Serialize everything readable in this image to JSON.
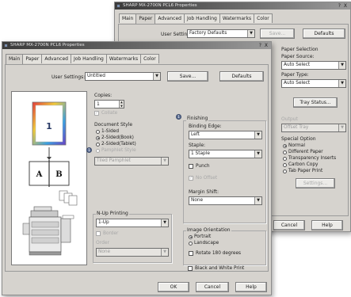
{
  "back": {
    "title": "SHARP MX-2700N PCL6 Properties",
    "close_glyph": "? X",
    "tabs": [
      "Main",
      "Paper",
      "Advanced",
      "Job Handling",
      "Watermarks",
      "Color"
    ],
    "user_settings_label": "User Settings:",
    "user_settings_value": "Factory Defaults",
    "save_label": "Save...",
    "defaults_label": "Defaults",
    "paper_selection_title": "Paper Selection",
    "paper_source_label": "Paper Source:",
    "paper_source_value": "Auto Select",
    "paper_type_label": "Paper Type:",
    "paper_type_value": "Auto Select",
    "tray_status_label": "Tray Status...",
    "output_label": "Output",
    "output_value": "Offset Tray",
    "special_option_title": "Special Option",
    "special_options": [
      "Normal",
      "Different Paper",
      "Transparency Inserts",
      "Carbon Copy",
      "Tab Paper Print"
    ],
    "settings_label": "Settings...",
    "cancel_label": "Cancel",
    "help_label": "Help"
  },
  "front": {
    "title": "SHARP MX-2700N PCL6 Properties",
    "close_glyph": "? X",
    "tabs": [
      "Main",
      "Paper",
      "Advanced",
      "Job Handling",
      "Watermarks",
      "Color"
    ],
    "user_settings_label": "User Settings:",
    "user_settings_value": "Untitled",
    "save_label": "Save...",
    "defaults_label": "Defaults",
    "copies_label": "Copies:",
    "copies_value": "1",
    "collate_label": "Collate",
    "document_style_title": "Document Style",
    "document_styles": [
      "1-Sided",
      "2-Sided(Book)",
      "2-Sided(Tablet)",
      "Pamphlet Style"
    ],
    "pamphlet_value": "Tiled Pamphlet",
    "nup_title": "N-Up Printing",
    "nup_value": "1-Up",
    "border_label": "Border",
    "order_label": "Order",
    "order_value": "None",
    "finishing_title": "Finishing",
    "binding_edge_label": "Binding Edge:",
    "binding_edge_value": "Left",
    "staple_label": "Staple:",
    "staple_value": "1 Staple",
    "punch_label": "Punch",
    "no_offset_label": "No Offset",
    "margin_shift_label": "Margin Shift:",
    "margin_shift_value": "None",
    "orientation_title": "Image Orientation",
    "orientations": [
      "Portrait",
      "Landscape"
    ],
    "rotate_label": "Rotate 180 degrees",
    "bw_label": "Black and White Print",
    "badge_1": "1",
    "badge_2": "1",
    "preview_page_number": "1",
    "preview_letter_a": "A",
    "preview_letter_b": "B",
    "ok_label": "OK",
    "cancel_label": "Cancel",
    "help_label": "Help"
  },
  "colors": {
    "dialog_bg": "#d6d3ce",
    "page_thumb_gradient": [
      "#e23b3b",
      "#f0c93a",
      "#3aa0e0",
      "#6a3fc2"
    ],
    "badge": "#5d6f93"
  }
}
